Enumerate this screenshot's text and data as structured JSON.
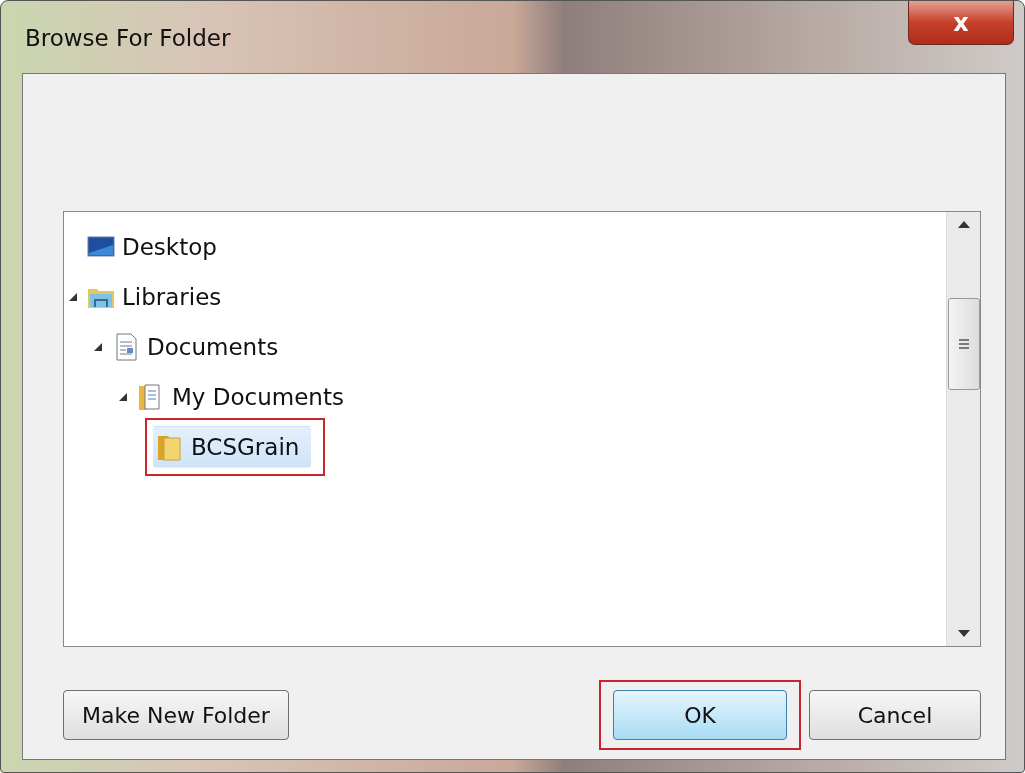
{
  "window": {
    "title": "Browse For Folder",
    "close_label": "x"
  },
  "tree": [
    {
      "label": "Desktop",
      "kind": "desktop",
      "selected": false,
      "highlighted": false
    },
    {
      "label": "Libraries",
      "kind": "libraries",
      "selected": false,
      "highlighted": false,
      "expanded": true,
      "children": [
        {
          "label": "Documents",
          "kind": "document",
          "selected": false,
          "highlighted": false,
          "expanded": true,
          "children": [
            {
              "label": "My Documents",
              "kind": "docfolder",
              "selected": false,
              "highlighted": false,
              "expanded": true,
              "children": [
                {
                  "label": "BCSGrain",
                  "kind": "folder",
                  "selected": true,
                  "highlighted": true
                }
              ]
            }
          ]
        }
      ]
    }
  ],
  "buttons": [
    {
      "label": "Make New Folder",
      "kind": "secondary",
      "highlighted": false
    },
    {
      "label": "OK",
      "kind": "default",
      "highlighted": true
    },
    {
      "label": "Cancel",
      "kind": "secondary",
      "highlighted": false
    }
  ]
}
